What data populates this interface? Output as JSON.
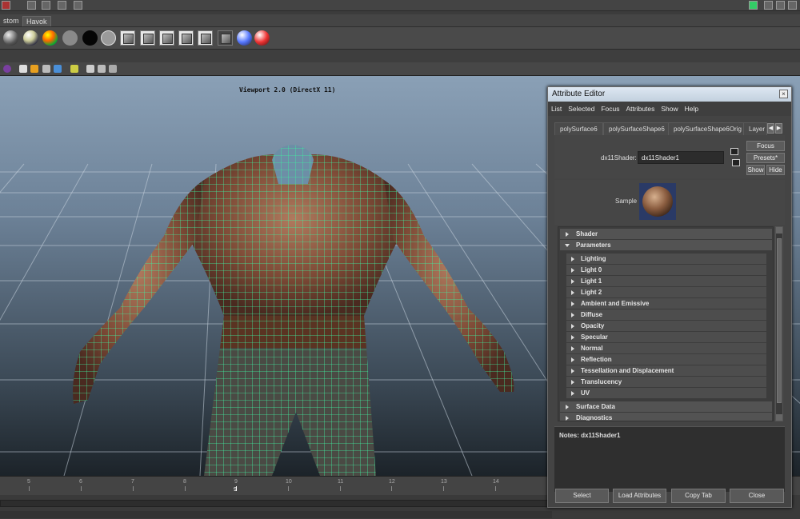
{
  "shelf_tabs": [
    "stom",
    "Havok"
  ],
  "viewport": {
    "title": "Viewport 2.0 (DirectX 11)"
  },
  "timeline": {
    "ticks": [
      "5",
      "6",
      "7",
      "8",
      "9",
      "10",
      "11",
      "12",
      "13",
      "14"
    ],
    "current": "9"
  },
  "attribute_editor": {
    "title": "Attribute Editor",
    "menu": [
      "List",
      "Selected",
      "Focus",
      "Attributes",
      "Show",
      "Help"
    ],
    "tabs": [
      "polySurface6",
      "polySurfaceShape6",
      "polySurfaceShape6Orig",
      "Layer"
    ],
    "shader_label": "dx11Shader:",
    "shader_value": "dx11Shader1",
    "buttons": {
      "focus": "Focus",
      "presets": "Presets*",
      "show": "Show",
      "hide": "Hide"
    },
    "sample_label": "Sample",
    "sections": {
      "shader": "Shader",
      "parameters": "Parameters",
      "surface_data": "Surface Data",
      "diagnostics": "Diagnostics"
    },
    "parameters": [
      "Lighting",
      "Light 0",
      "Light 1",
      "Light 2",
      "Ambient and Emissive",
      "Diffuse",
      "Opacity",
      "Specular",
      "Normal",
      "Reflection",
      "Tessellation and Displacement",
      "Translucency",
      "UV"
    ],
    "notes": "Notes: dx11Shader1",
    "footer": {
      "select": "Select",
      "load_attributes": "Load Attributes",
      "copy_tab": "Copy Tab",
      "close": "Close"
    }
  }
}
